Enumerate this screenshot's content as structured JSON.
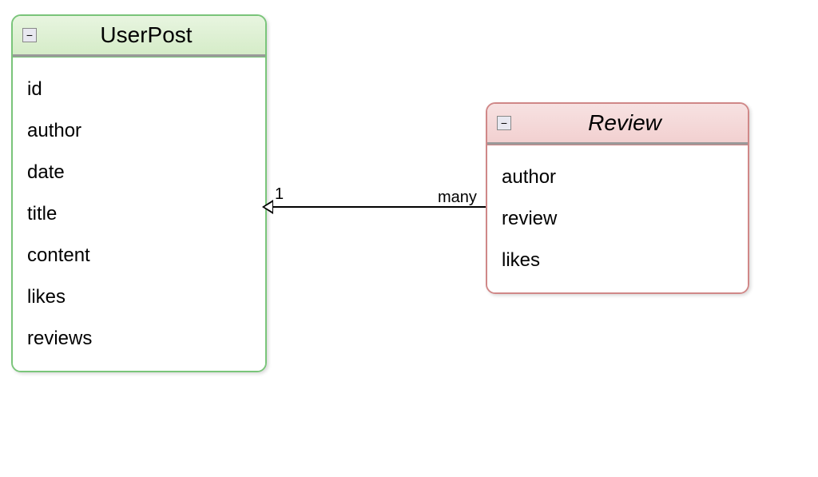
{
  "entities": {
    "userpost": {
      "title": "UserPost",
      "toggle": "−",
      "attributes": [
        "id",
        "author",
        "date",
        "title",
        "content",
        "likes",
        "reviews"
      ]
    },
    "review": {
      "title": "Review",
      "toggle": "−",
      "attributes": [
        "author",
        "review",
        "likes"
      ]
    }
  },
  "relationship": {
    "from": "Review",
    "to": "UserPost",
    "from_cardinality": "many",
    "to_cardinality": "1"
  }
}
